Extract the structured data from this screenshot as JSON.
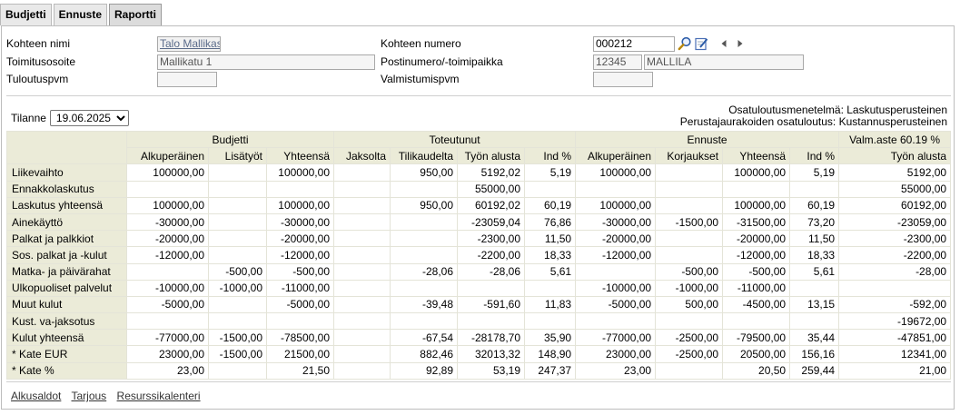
{
  "tabs": [
    {
      "label": "Budjetti"
    },
    {
      "label": "Ennuste"
    },
    {
      "label": "Raportti"
    }
  ],
  "info": {
    "kohteen_nimi_label": "Kohteen nimi",
    "kohteen_nimi_value": "Talo Mallikas",
    "toimitusosoite_label": "Toimitusosoite",
    "toimitusosoite_value": "Mallikatu 1",
    "tuloutuspvm_label": "Tuloutuspvm",
    "tuloutuspvm_value": "",
    "kohteen_numero_label": "Kohteen numero",
    "kohteen_numero_value": "000212",
    "postinumero_label": "Postinumero/-toimipaikka",
    "postinumero_value": "12345",
    "toimipaikka_value": "MALLILA",
    "valmistumispvm_label": "Valmistumispvm",
    "valmistumispvm_value": ""
  },
  "tilanne": {
    "label": "Tilanne",
    "selected": "19.06.2025"
  },
  "methods": {
    "line1": "Osatuloutusmenetelmä: Laskutusperusteinen",
    "line2": "Perustajaurakoiden osatuloutus: Kustannusperusteinen"
  },
  "table": {
    "group_headers": {
      "budjetti": "Budjetti",
      "toteutunut": "Toteutunut",
      "ennuste": "Ennuste",
      "valm": "Valm.aste 60.19 %"
    },
    "sub_headers": {
      "b_alku": "Alkuperäinen",
      "b_lisa": "Lisätyöt",
      "b_yht": "Yhteensä",
      "t_jakso": "Jaksolta",
      "t_tili": "Tilikaudelta",
      "t_alusta": "Työn alusta",
      "t_ind": "Ind %",
      "e_alku": "Alkuperäinen",
      "e_korj": "Korjaukset",
      "e_yht": "Yhteensä",
      "e_ind": "Ind %",
      "v_alusta": "Työn alusta"
    },
    "rows": [
      {
        "label": "Liikevaihto",
        "cells": [
          "100000,00",
          "",
          "100000,00",
          "",
          "950,00",
          "5192,02",
          "5,19",
          "100000,00",
          "",
          "100000,00",
          "5,19",
          "5192,00"
        ]
      },
      {
        "label": "Ennakkolaskutus",
        "cells": [
          "",
          "",
          "",
          "",
          "",
          "55000,00",
          "",
          "",
          "",
          "",
          "",
          "55000,00"
        ]
      },
      {
        "label": "Laskutus yhteensä",
        "cells": [
          "100000,00",
          "",
          "100000,00",
          "",
          "950,00",
          "60192,02",
          "60,19",
          "100000,00",
          "",
          "100000,00",
          "60,19",
          "60192,00"
        ]
      },
      {
        "label": "Ainekäyttö",
        "cells": [
          "-30000,00",
          "",
          "-30000,00",
          "",
          "",
          "-23059,04",
          "76,86",
          "-30000,00",
          "-1500,00",
          "-31500,00",
          "73,20",
          "-23059,00"
        ]
      },
      {
        "label": "Palkat ja palkkiot",
        "cells": [
          "-20000,00",
          "",
          "-20000,00",
          "",
          "",
          "-2300,00",
          "11,50",
          "-20000,00",
          "",
          "-20000,00",
          "11,50",
          "-2300,00"
        ]
      },
      {
        "label": "Sos. palkat ja -kulut",
        "cells": [
          "-12000,00",
          "",
          "-12000,00",
          "",
          "",
          "-2200,00",
          "18,33",
          "-12000,00",
          "",
          "-12000,00",
          "18,33",
          "-2200,00"
        ]
      },
      {
        "label": "Matka- ja päivärahat",
        "cells": [
          "",
          "-500,00",
          "-500,00",
          "",
          "-28,06",
          "-28,06",
          "5,61",
          "",
          "-500,00",
          "-500,00",
          "5,61",
          "-28,00"
        ]
      },
      {
        "label": "Ulkopuoliset palvelut",
        "cells": [
          "-10000,00",
          "-1000,00",
          "-11000,00",
          "",
          "",
          "",
          "",
          "-10000,00",
          "-1000,00",
          "-11000,00",
          "",
          ""
        ]
      },
      {
        "label": "Muut kulut",
        "cells": [
          "-5000,00",
          "",
          "-5000,00",
          "",
          "-39,48",
          "-591,60",
          "11,83",
          "-5000,00",
          "500,00",
          "-4500,00",
          "13,15",
          "-592,00"
        ]
      },
      {
        "label": "Kust. va-jaksotus",
        "cells": [
          "",
          "",
          "",
          "",
          "",
          "",
          "",
          "",
          "",
          "",
          "",
          "-19672,00"
        ]
      },
      {
        "label": "Kulut yhteensä",
        "cells": [
          "-77000,00",
          "-1500,00",
          "-78500,00",
          "",
          "-67,54",
          "-28178,70",
          "35,90",
          "-77000,00",
          "-2500,00",
          "-79500,00",
          "35,44",
          "-47851,00"
        ]
      },
      {
        "label": "* Kate EUR",
        "cells": [
          "23000,00",
          "-1500,00",
          "21500,00",
          "",
          "882,46",
          "32013,32",
          "148,90",
          "23000,00",
          "-2500,00",
          "20500,00",
          "156,16",
          "12341,00"
        ]
      },
      {
        "label": "* Kate %",
        "cells": [
          "23,00",
          "",
          "21,50",
          "",
          "92,89",
          "53,19",
          "247,37",
          "23,00",
          "",
          "20,50",
          "259,44",
          "21,00"
        ]
      }
    ]
  },
  "footer": {
    "links": [
      "Alkusaldot",
      "Tarjous",
      "Resurssikalenteri"
    ]
  },
  "colors": {
    "header_bg": "#ebebd8",
    "tab_active": "#dcdcdc"
  }
}
